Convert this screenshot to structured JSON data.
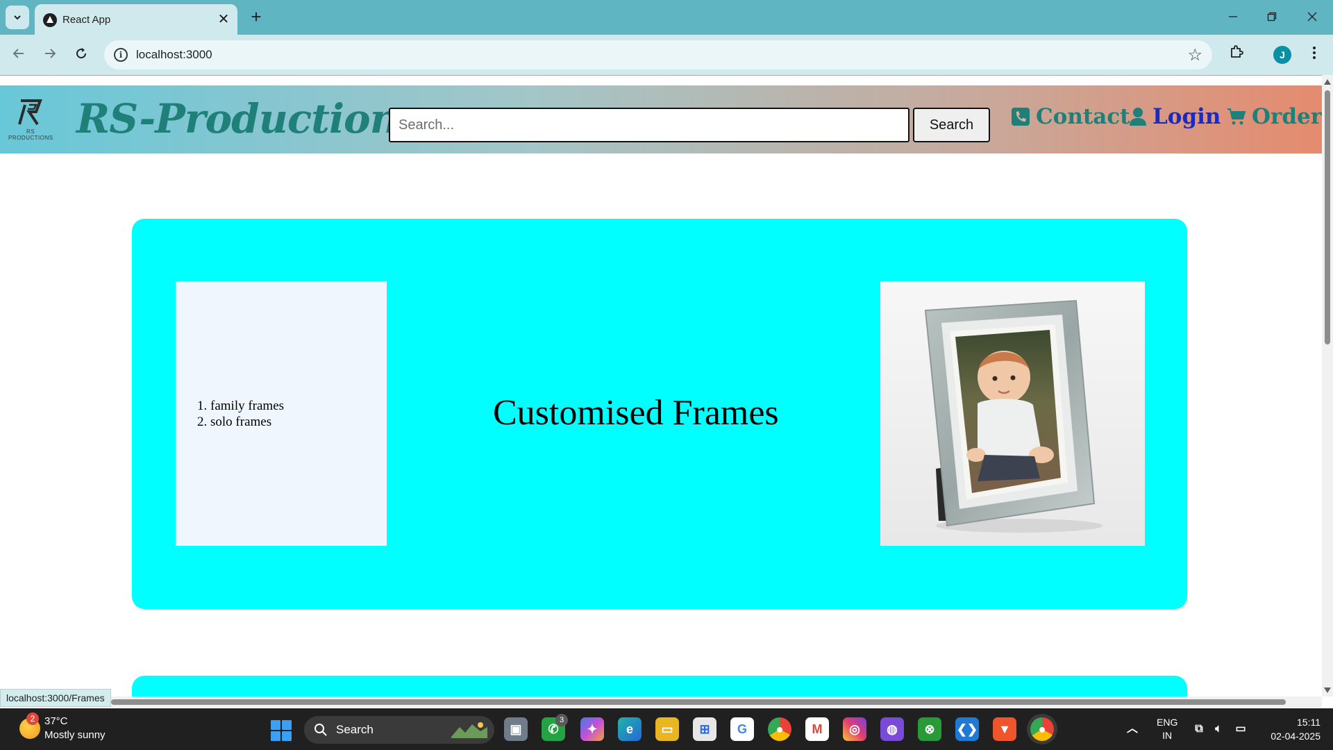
{
  "browser": {
    "tab_title": "React App",
    "tab_close": "✕",
    "new_tab": "+",
    "address": "localhost:3000",
    "status_url": "localhost:3000/Frames",
    "profile_initial": "J"
  },
  "navbar": {
    "logo_text": "RS PRODUCTIONS",
    "brand": "RS-Productions",
    "search_placeholder": "Search...",
    "search_button": "Search",
    "links": {
      "contact": "Contact",
      "login": "Login",
      "orders": "Orders"
    }
  },
  "card": {
    "list": [
      "family frames",
      "solo frames"
    ],
    "title": "Customised Frames",
    "image": "framed-baby-photo"
  },
  "colors": {
    "card_bg": "#00ffff",
    "brand": "#1f7f79",
    "login": "#1f2bb8"
  },
  "taskbar": {
    "weather_badge": "2",
    "temperature": "37°C",
    "condition": "Mostly sunny",
    "search_label": "Search",
    "whatsapp_badge": "3",
    "language": "ENG",
    "region": "IN",
    "time": "15:11",
    "date": "02-04-2025"
  }
}
